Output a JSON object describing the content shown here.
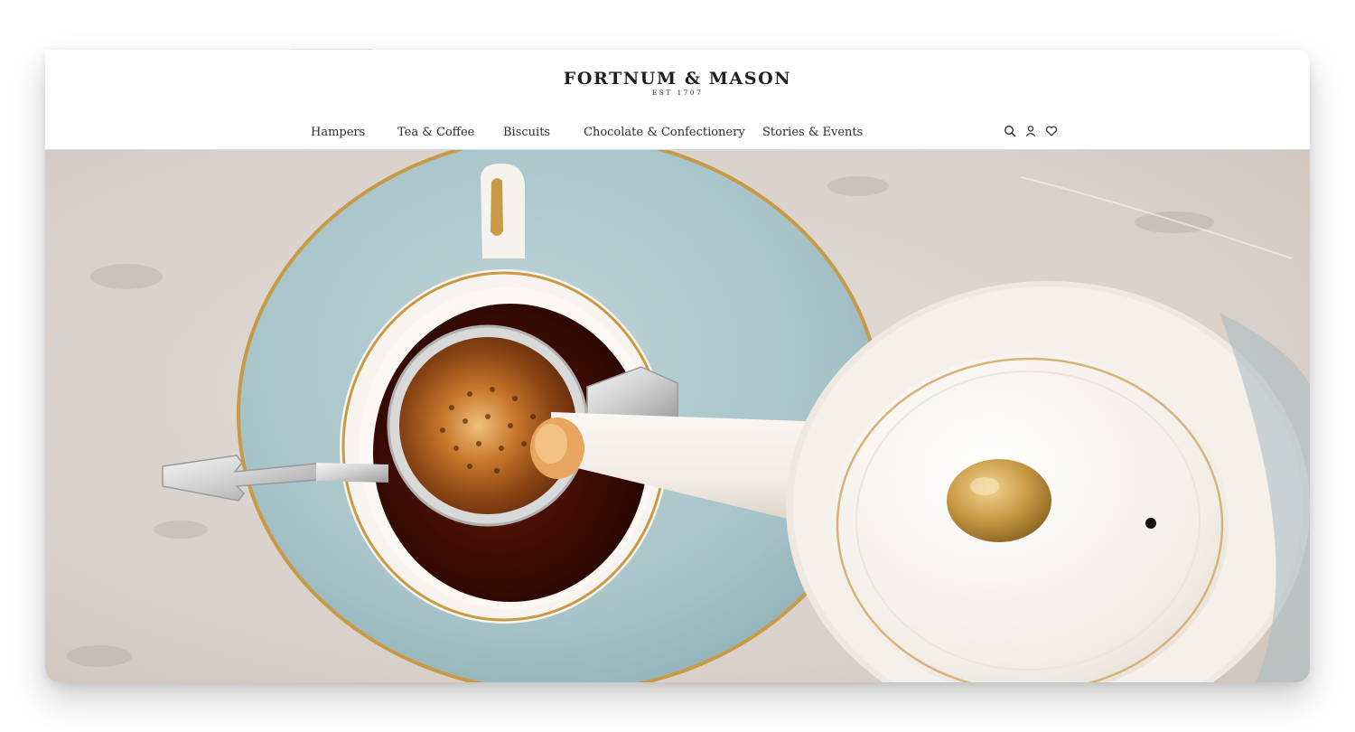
{
  "brand": {
    "name": "FORTNUM & MASON",
    "established": "EST 1707"
  },
  "nav": {
    "items": [
      {
        "label": "Hampers"
      },
      {
        "label": "Tea & Coffee"
      },
      {
        "label": "Biscuits"
      },
      {
        "label": "Chocolate & Confectionery"
      },
      {
        "label": "Stories & Events"
      }
    ]
  },
  "header_icons": [
    "search-icon",
    "account-icon",
    "wishlist-heart-icon"
  ],
  "colors": {
    "accent_rule": "#bfe3e6",
    "text": "#2b2b2b",
    "marble": "#d9d2cb",
    "saucer": "#a9c7cc",
    "gold": "#c99a45",
    "porcelain": "#f4efe9",
    "tea": "#3a0d05"
  },
  "hero": {
    "image": "Overhead photo of a gold-rimmed teacup on a pale blue saucer with a silver tea strainer, tea being poured from a white teapot on marble"
  }
}
